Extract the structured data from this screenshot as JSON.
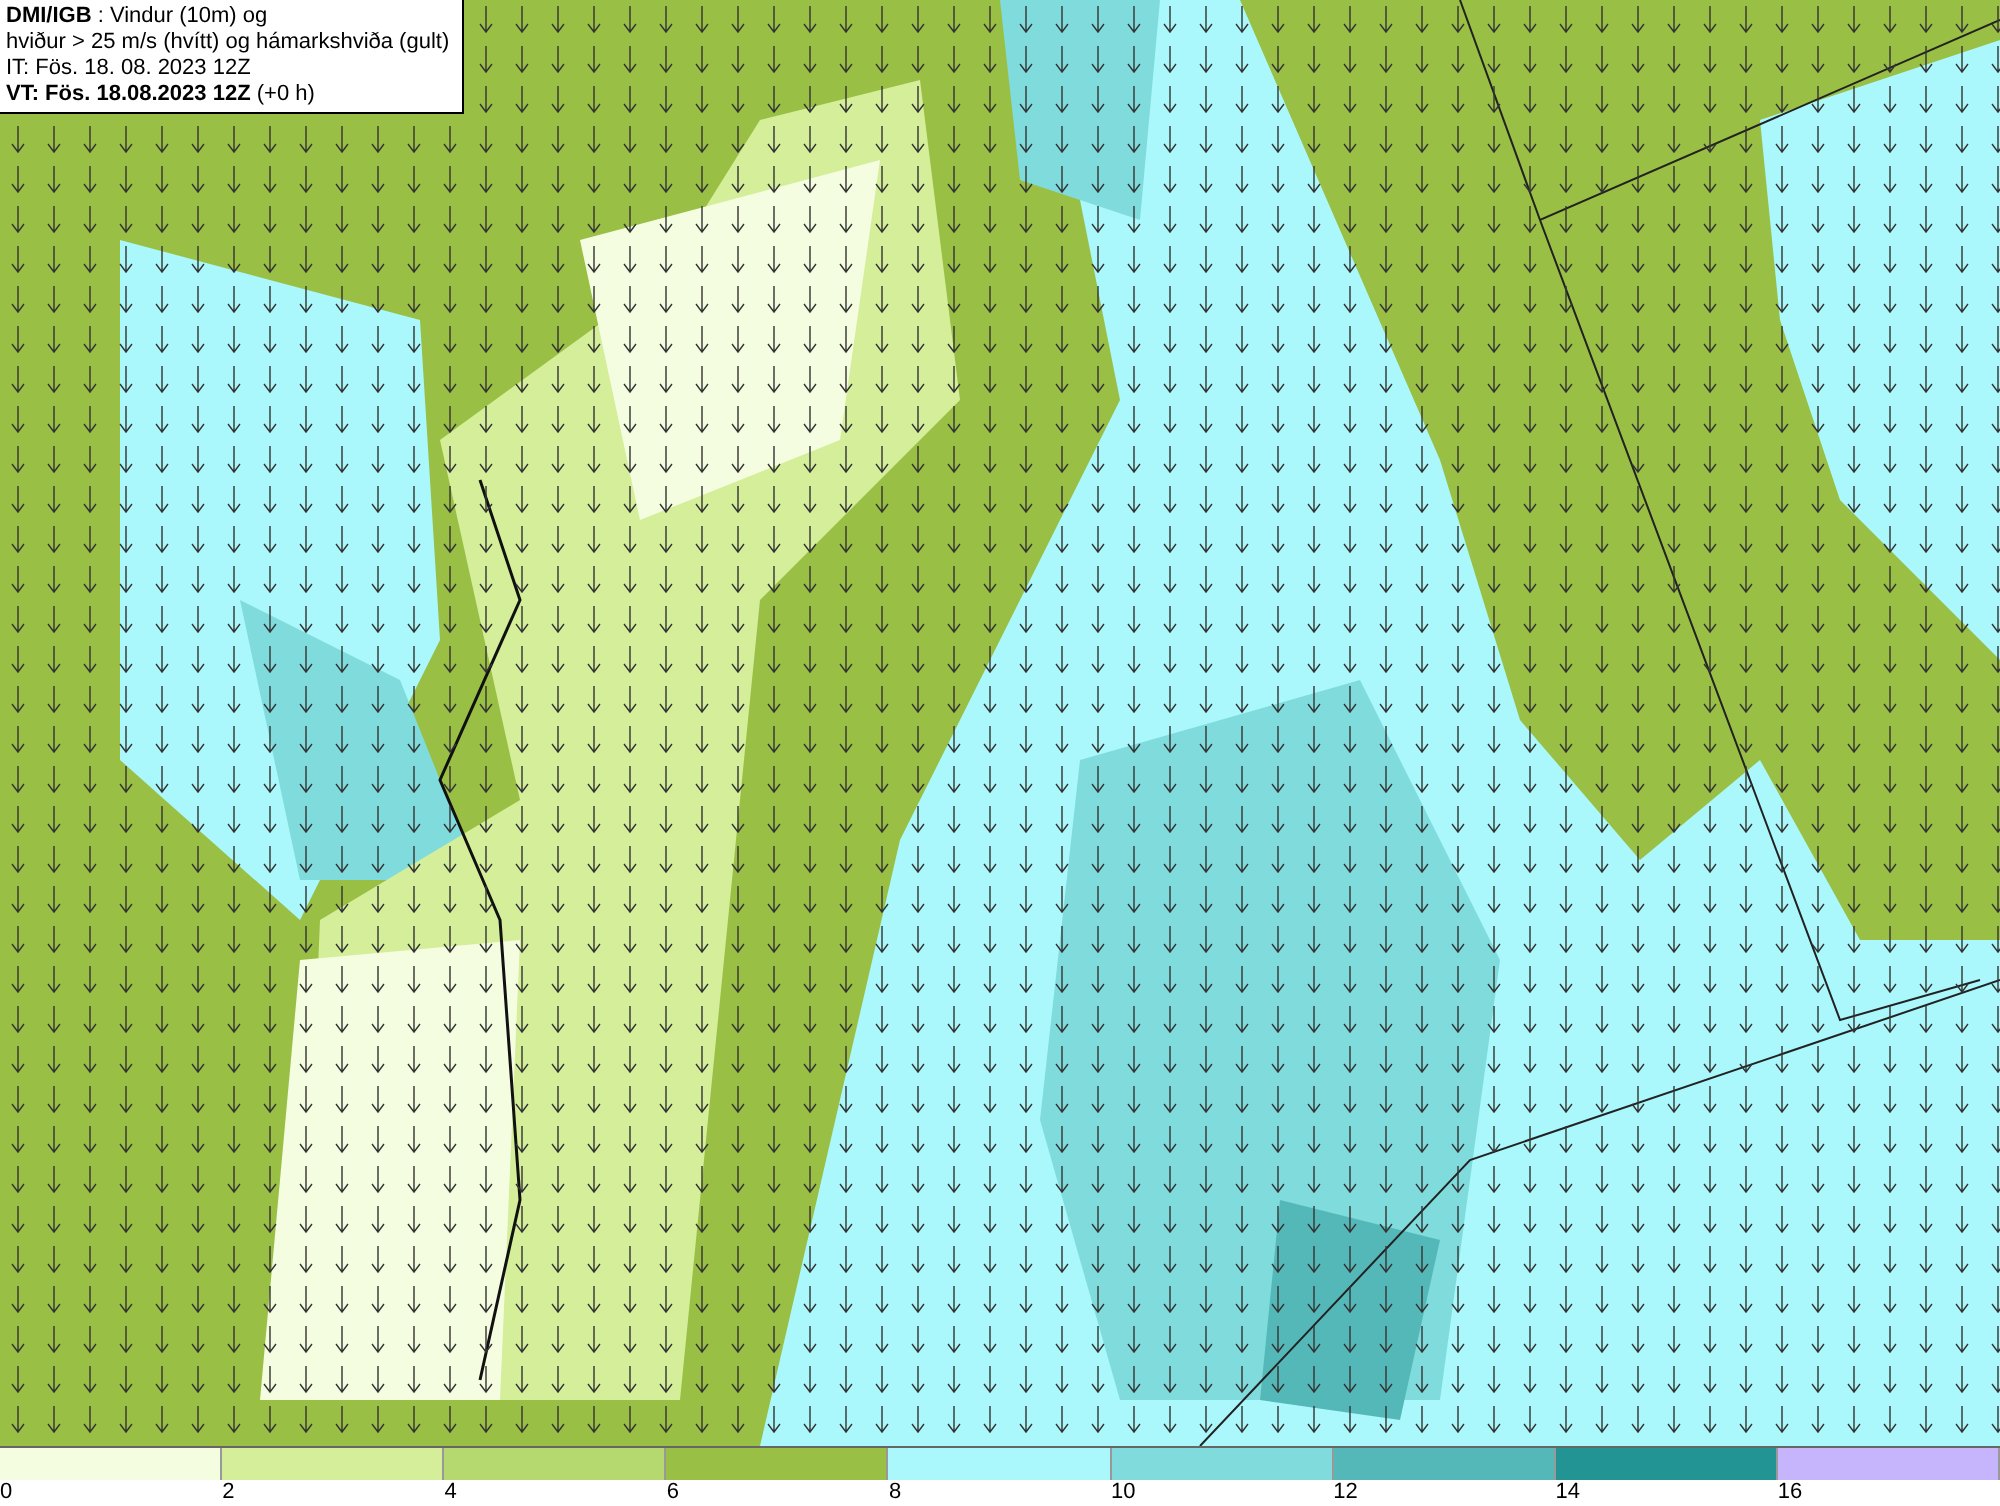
{
  "header": {
    "lines": [
      "**DMI/IGB** : Vindur (10m) og",
      "hviður > 25 m/s (hvítt) og hámarkshviða (gult)",
      "IT: Fös. 18. 08. 2023 12Z",
      "**VT: Fös. 18.08.2023 12Z** (+0 h)"
    ]
  },
  "legend": [
    {
      "label": "0",
      "color": "#f5fde0"
    },
    {
      "label": "2",
      "color": "#d4ee9a"
    },
    {
      "label": "4",
      "color": "#b5d96e"
    },
    {
      "label": "6",
      "color": "#99bf44"
    },
    {
      "label": "8",
      "color": "#aaf8fc"
    },
    {
      "label": "10",
      "color": "#80dcdc"
    },
    {
      "label": "12",
      "color": "#55b8b8"
    },
    {
      "label": "14",
      "color": "#229494"
    },
    {
      "label": "16",
      "color": "#c6b4fc"
    }
  ]
}
